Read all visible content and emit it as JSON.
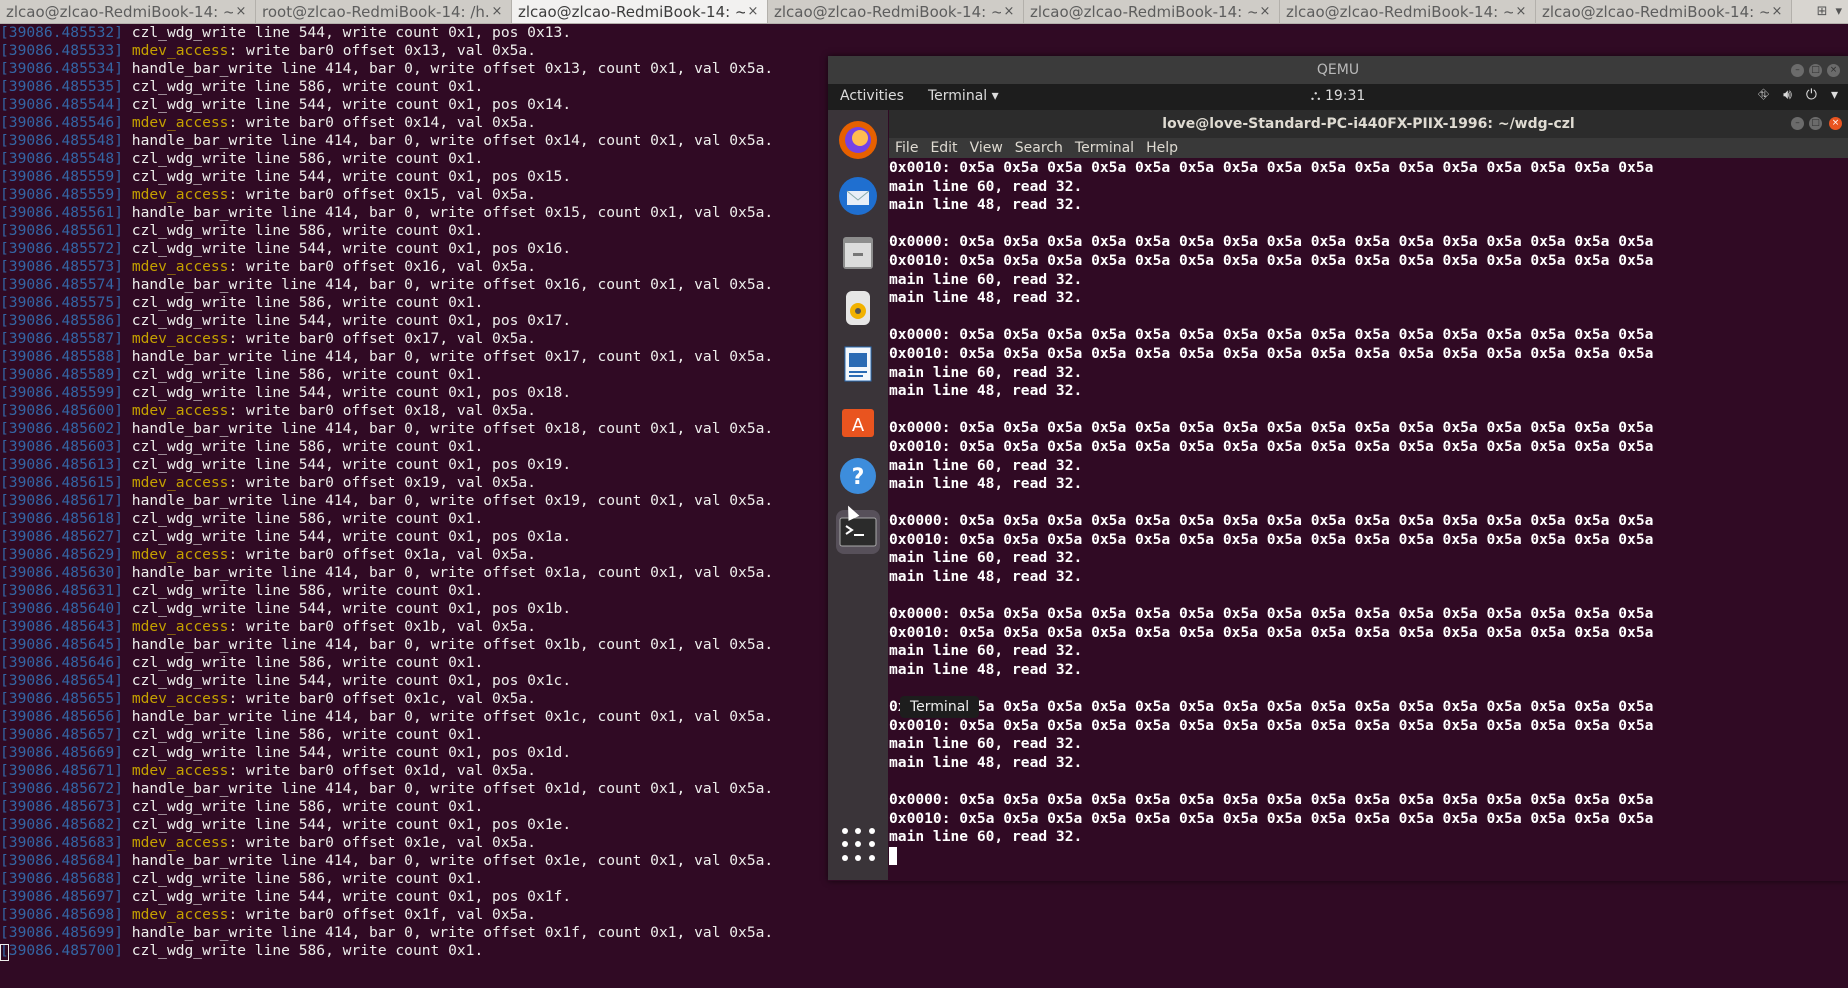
{
  "tabs": [
    {
      "label": "zlcao@zlcao-RedmiBook-14: ~...",
      "close": "×"
    },
    {
      "label": "root@zlcao-RedmiBook-14: /h...",
      "close": "×"
    },
    {
      "label": "zlcao@zlcao-RedmiBook-14: ~...",
      "close": "×",
      "active": true
    },
    {
      "label": "zlcao@zlcao-RedmiBook-14: ~...",
      "close": "×"
    },
    {
      "label": "zlcao@zlcao-RedmiBook-14: ~...",
      "close": "×"
    },
    {
      "label": "zlcao@zlcao-RedmiBook-14: ~...",
      "close": "×"
    },
    {
      "label": "zlcao@zlcao-RedmiBook-14: ~...",
      "close": "×"
    }
  ],
  "host_lines": [
    {
      "ts": "[39086.485532]",
      "pre": "",
      "mdev": "",
      "text": " czl_wdg_write line 544, write count 0x1, pos 0x13."
    },
    {
      "ts": "[39086.485533]",
      "pre": " ",
      "mdev": "mdev_access",
      "text": ": write bar0 offset 0x13, val 0x5a."
    },
    {
      "ts": "[39086.485534]",
      "pre": "",
      "mdev": "",
      "text": " handle_bar_write line 414, bar 0, write offset 0x13, count 0x1, val 0x5a."
    },
    {
      "ts": "[39086.485535]",
      "pre": "",
      "mdev": "",
      "text": " czl_wdg_write line 586, write count 0x1."
    },
    {
      "ts": "[39086.485544]",
      "pre": "",
      "mdev": "",
      "text": " czl_wdg_write line 544, write count 0x1, pos 0x14."
    },
    {
      "ts": "[39086.485546]",
      "pre": " ",
      "mdev": "mdev_access",
      "text": ": write bar0 offset 0x14, val 0x5a."
    },
    {
      "ts": "[39086.485548]",
      "pre": "",
      "mdev": "",
      "text": " handle_bar_write line 414, bar 0, write offset 0x14, count 0x1, val 0x5a."
    },
    {
      "ts": "[39086.485548]",
      "pre": "",
      "mdev": "",
      "text": " czl_wdg_write line 586, write count 0x1."
    },
    {
      "ts": "[39086.485559]",
      "pre": "",
      "mdev": "",
      "text": " czl_wdg_write line 544, write count 0x1, pos 0x15."
    },
    {
      "ts": "[39086.485559]",
      "pre": " ",
      "mdev": "mdev_access",
      "text": ": write bar0 offset 0x15, val 0x5a."
    },
    {
      "ts": "[39086.485561]",
      "pre": "",
      "mdev": "",
      "text": " handle_bar_write line 414, bar 0, write offset 0x15, count 0x1, val 0x5a."
    },
    {
      "ts": "[39086.485561]",
      "pre": "",
      "mdev": "",
      "text": " czl_wdg_write line 586, write count 0x1."
    },
    {
      "ts": "[39086.485572]",
      "pre": "",
      "mdev": "",
      "text": " czl_wdg_write line 544, write count 0x1, pos 0x16."
    },
    {
      "ts": "[39086.485573]",
      "pre": " ",
      "mdev": "mdev_access",
      "text": ": write bar0 offset 0x16, val 0x5a."
    },
    {
      "ts": "[39086.485574]",
      "pre": "",
      "mdev": "",
      "text": " handle_bar_write line 414, bar 0, write offset 0x16, count 0x1, val 0x5a."
    },
    {
      "ts": "[39086.485575]",
      "pre": "",
      "mdev": "",
      "text": " czl_wdg_write line 586, write count 0x1."
    },
    {
      "ts": "[39086.485586]",
      "pre": "",
      "mdev": "",
      "text": " czl_wdg_write line 544, write count 0x1, pos 0x17."
    },
    {
      "ts": "[39086.485587]",
      "pre": " ",
      "mdev": "mdev_access",
      "text": ": write bar0 offset 0x17, val 0x5a."
    },
    {
      "ts": "[39086.485588]",
      "pre": "",
      "mdev": "",
      "text": " handle_bar_write line 414, bar 0, write offset 0x17, count 0x1, val 0x5a."
    },
    {
      "ts": "[39086.485589]",
      "pre": "",
      "mdev": "",
      "text": " czl_wdg_write line 586, write count 0x1."
    },
    {
      "ts": "[39086.485599]",
      "pre": "",
      "mdev": "",
      "text": " czl_wdg_write line 544, write count 0x1, pos 0x18."
    },
    {
      "ts": "[39086.485600]",
      "pre": " ",
      "mdev": "mdev_access",
      "text": ": write bar0 offset 0x18, val 0x5a."
    },
    {
      "ts": "[39086.485602]",
      "pre": "",
      "mdev": "",
      "text": " handle_bar_write line 414, bar 0, write offset 0x18, count 0x1, val 0x5a."
    },
    {
      "ts": "[39086.485603]",
      "pre": "",
      "mdev": "",
      "text": " czl_wdg_write line 586, write count 0x1."
    },
    {
      "ts": "[39086.485613]",
      "pre": "",
      "mdev": "",
      "text": " czl_wdg_write line 544, write count 0x1, pos 0x19."
    },
    {
      "ts": "[39086.485615]",
      "pre": " ",
      "mdev": "mdev_access",
      "text": ": write bar0 offset 0x19, val 0x5a."
    },
    {
      "ts": "[39086.485617]",
      "pre": "",
      "mdev": "",
      "text": " handle_bar_write line 414, bar 0, write offset 0x19, count 0x1, val 0x5a."
    },
    {
      "ts": "[39086.485618]",
      "pre": "",
      "mdev": "",
      "text": " czl_wdg_write line 586, write count 0x1."
    },
    {
      "ts": "[39086.485627]",
      "pre": "",
      "mdev": "",
      "text": " czl_wdg_write line 544, write count 0x1, pos 0x1a."
    },
    {
      "ts": "[39086.485629]",
      "pre": " ",
      "mdev": "mdev_access",
      "text": ": write bar0 offset 0x1a, val 0x5a."
    },
    {
      "ts": "[39086.485630]",
      "pre": "",
      "mdev": "",
      "text": " handle_bar_write line 414, bar 0, write offset 0x1a, count 0x1, val 0x5a."
    },
    {
      "ts": "[39086.485631]",
      "pre": "",
      "mdev": "",
      "text": " czl_wdg_write line 586, write count 0x1."
    },
    {
      "ts": "[39086.485640]",
      "pre": "",
      "mdev": "",
      "text": " czl_wdg_write line 544, write count 0x1, pos 0x1b."
    },
    {
      "ts": "[39086.485643]",
      "pre": " ",
      "mdev": "mdev_access",
      "text": ": write bar0 offset 0x1b, val 0x5a."
    },
    {
      "ts": "[39086.485645]",
      "pre": "",
      "mdev": "",
      "text": " handle_bar_write line 414, bar 0, write offset 0x1b, count 0x1, val 0x5a."
    },
    {
      "ts": "[39086.485646]",
      "pre": "",
      "mdev": "",
      "text": " czl_wdg_write line 586, write count 0x1."
    },
    {
      "ts": "[39086.485654]",
      "pre": "",
      "mdev": "",
      "text": " czl_wdg_write line 544, write count 0x1, pos 0x1c."
    },
    {
      "ts": "[39086.485655]",
      "pre": " ",
      "mdev": "mdev_access",
      "text": ": write bar0 offset 0x1c, val 0x5a."
    },
    {
      "ts": "[39086.485656]",
      "pre": "",
      "mdev": "",
      "text": " handle_bar_write line 414, bar 0, write offset 0x1c, count 0x1, val 0x5a."
    },
    {
      "ts": "[39086.485657]",
      "pre": "",
      "mdev": "",
      "text": " czl_wdg_write line 586, write count 0x1."
    },
    {
      "ts": "[39086.485669]",
      "pre": "",
      "mdev": "",
      "text": " czl_wdg_write line 544, write count 0x1, pos 0x1d."
    },
    {
      "ts": "[39086.485671]",
      "pre": " ",
      "mdev": "mdev_access",
      "text": ": write bar0 offset 0x1d, val 0x5a."
    },
    {
      "ts": "[39086.485672]",
      "pre": "",
      "mdev": "",
      "text": " handle_bar_write line 414, bar 0, write offset 0x1d, count 0x1, val 0x5a."
    },
    {
      "ts": "[39086.485673]",
      "pre": "",
      "mdev": "",
      "text": " czl_wdg_write line 586, write count 0x1."
    },
    {
      "ts": "[39086.485682]",
      "pre": "",
      "mdev": "",
      "text": " czl_wdg_write line 544, write count 0x1, pos 0x1e."
    },
    {
      "ts": "[39086.485683]",
      "pre": " ",
      "mdev": "mdev_access",
      "text": ": write bar0 offset 0x1e, val 0x5a."
    },
    {
      "ts": "[39086.485684]",
      "pre": "",
      "mdev": "",
      "text": " handle_bar_write line 414, bar 0, write offset 0x1e, count 0x1, val 0x5a."
    },
    {
      "ts": "[39086.485688]",
      "pre": "",
      "mdev": "",
      "text": " czl_wdg_write line 586, write count 0x1."
    },
    {
      "ts": "[39086.485697]",
      "pre": "",
      "mdev": "",
      "text": " czl_wdg_write line 544, write count 0x1, pos 0x1f."
    },
    {
      "ts": "[39086.485698]",
      "pre": " ",
      "mdev": "mdev_access",
      "text": ": write bar0 offset 0x1f, val 0x5a."
    },
    {
      "ts": "[39086.485699]",
      "pre": "",
      "mdev": "",
      "text": " handle_bar_write line 414, bar 0, write offset 0x1f, count 0x1, val 0x5a."
    },
    {
      "ts": "[39086.485700]",
      "pre": "",
      "mdev": "",
      "text": " czl_wdg_write line 586, write count 0x1."
    }
  ],
  "qemu": {
    "title": "QEMU",
    "topbar": {
      "activities": "Activities",
      "app_menu": "Terminal ▾",
      "clock": "⛬ 19:31"
    },
    "dock_tooltip": "Terminal",
    "terminal": {
      "title": "love@love-Standard-PC-i440FX-PIIX-1996: ~/wdg-czl",
      "menu": [
        "File",
        "Edit",
        "View",
        "Search",
        "Terminal",
        "Help"
      ],
      "lines": [
        "0x0010: 0x5a 0x5a 0x5a 0x5a 0x5a 0x5a 0x5a 0x5a 0x5a 0x5a 0x5a 0x5a 0x5a 0x5a 0x5a 0x5a",
        "main line 60, read 32.",
        "main line 48, read 32.",
        "",
        "0x0000: 0x5a 0x5a 0x5a 0x5a 0x5a 0x5a 0x5a 0x5a 0x5a 0x5a 0x5a 0x5a 0x5a 0x5a 0x5a 0x5a",
        "0x0010: 0x5a 0x5a 0x5a 0x5a 0x5a 0x5a 0x5a 0x5a 0x5a 0x5a 0x5a 0x5a 0x5a 0x5a 0x5a 0x5a",
        "main line 60, read 32.",
        "main line 48, read 32.",
        "",
        "0x0000: 0x5a 0x5a 0x5a 0x5a 0x5a 0x5a 0x5a 0x5a 0x5a 0x5a 0x5a 0x5a 0x5a 0x5a 0x5a 0x5a",
        "0x0010: 0x5a 0x5a 0x5a 0x5a 0x5a 0x5a 0x5a 0x5a 0x5a 0x5a 0x5a 0x5a 0x5a 0x5a 0x5a 0x5a",
        "main line 60, read 32.",
        "main line 48, read 32.",
        "",
        "0x0000: 0x5a 0x5a 0x5a 0x5a 0x5a 0x5a 0x5a 0x5a 0x5a 0x5a 0x5a 0x5a 0x5a 0x5a 0x5a 0x5a",
        "0x0010: 0x5a 0x5a 0x5a 0x5a 0x5a 0x5a 0x5a 0x5a 0x5a 0x5a 0x5a 0x5a 0x5a 0x5a 0x5a 0x5a",
        "main line 60, read 32.",
        "main line 48, read 32.",
        "",
        "0x0000: 0x5a 0x5a 0x5a 0x5a 0x5a 0x5a 0x5a 0x5a 0x5a 0x5a 0x5a 0x5a 0x5a 0x5a 0x5a 0x5a",
        "0x0010: 0x5a 0x5a 0x5a 0x5a 0x5a 0x5a 0x5a 0x5a 0x5a 0x5a 0x5a 0x5a 0x5a 0x5a 0x5a 0x5a",
        "main line 60, read 32.",
        "main line 48, read 32.",
        "",
        "0x0000: 0x5a 0x5a 0x5a 0x5a 0x5a 0x5a 0x5a 0x5a 0x5a 0x5a 0x5a 0x5a 0x5a 0x5a 0x5a 0x5a",
        "0x0010: 0x5a 0x5a 0x5a 0x5a 0x5a 0x5a 0x5a 0x5a 0x5a 0x5a 0x5a 0x5a 0x5a 0x5a 0x5a 0x5a",
        "main line 60, read 32.",
        "main line 48, read 32.",
        "",
        "0x0000: 0x5a 0x5a 0x5a 0x5a 0x5a 0x5a 0x5a 0x5a 0x5a 0x5a 0x5a 0x5a 0x5a 0x5a 0x5a 0x5a",
        "0x0010: 0x5a 0x5a 0x5a 0x5a 0x5a 0x5a 0x5a 0x5a 0x5a 0x5a 0x5a 0x5a 0x5a 0x5a 0x5a 0x5a",
        "main line 60, read 32.",
        "main line 48, read 32.",
        "",
        "0x0000: 0x5a 0x5a 0x5a 0x5a 0x5a 0x5a 0x5a 0x5a 0x5a 0x5a 0x5a 0x5a 0x5a 0x5a 0x5a 0x5a",
        "0x0010: 0x5a 0x5a 0x5a 0x5a 0x5a 0x5a 0x5a 0x5a 0x5a 0x5a 0x5a 0x5a 0x5a 0x5a 0x5a 0x5a",
        "main line 60, read 32."
      ]
    }
  },
  "colors": {
    "terminal_bg": "#300a24",
    "timestamp": "#3465a4",
    "mdev_access": "#c4a000"
  }
}
